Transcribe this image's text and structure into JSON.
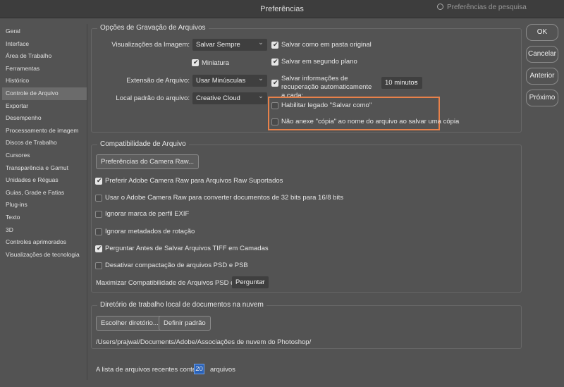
{
  "window": {
    "title": "Preferências",
    "search_placeholder": "Preferências de pesquisa"
  },
  "sidebar": {
    "items": [
      "Geral",
      "Interface",
      "Área de Trabalho",
      "Ferramentas",
      "Histórico",
      "Controle de Arquivo",
      "Exportar",
      "Desempenho",
      "Processamento de imagem",
      "Discos de Trabalho",
      "Cursores",
      "Transparência e Gamut",
      "Unidades e Réguas",
      "Guias, Grade e Fatias",
      "Plug-ins",
      "Texto",
      "3D",
      "Controles aprimorados",
      "Visualizações de tecnologia"
    ],
    "selected": "Controle de Arquivo"
  },
  "save_options": {
    "title": "Opções de Gravação de Arquivos",
    "image_previews_label": "Visualizações da Imagem:",
    "image_previews_value": "Salvar Sempre",
    "thumbnail": "Miniatura",
    "extension_label": "Extensão de Arquivo:",
    "extension_value": "Usar Minúsculas",
    "location_label": "Local padrão do arquivo:",
    "location_value": "Creative Cloud",
    "save_original": "Salvar como em pasta original",
    "save_background": "Salvar em segundo plano",
    "autosave": "Salvar informações de recuperação automaticamente a cada:",
    "autosave_value": "10 minutos",
    "legacy_save_as": "Habilitar legado \"Salvar como\"",
    "no_copy": "Não anexe \"cópia\" ao nome do arquivo ao salvar uma cópia"
  },
  "compat": {
    "title": "Compatibilidade de Arquivo",
    "camera_raw_btn": "Preferências do Camera Raw...",
    "options": [
      {
        "label": "Preferir Adobe Camera Raw para Arquivos Raw Suportados",
        "checked": true
      },
      {
        "label": "Usar o Adobe Camera Raw para converter documentos de 32 bits para 16/8 bits",
        "checked": false
      },
      {
        "label": "Ignorar marca de perfil EXIF",
        "checked": false
      },
      {
        "label": "Ignorar metadados de rotação",
        "checked": false
      },
      {
        "label": "Perguntar Antes de Salvar Arquivos TIFF em Camadas",
        "checked": true
      },
      {
        "label": "Desativar compactação de arquivos PSD e PSB",
        "checked": false
      }
    ],
    "maximize_label": "Maximizar Compatibilidade de Arquivos PSD e PSB:",
    "maximize_value": "Perguntar"
  },
  "cloud": {
    "title": "Diretório de trabalho local de documentos na nuvem",
    "choose_btn": "Escolher diretório...",
    "default_btn": "Definir padrão",
    "path": "/Users/prajwal/Documents/Adobe/Associações de nuvem do Photoshop/"
  },
  "recent": {
    "label": "A lista de arquivos recentes contém:",
    "value": "20",
    "unit": "arquivos"
  },
  "buttons": {
    "ok": "OK",
    "cancel": "Cancelar",
    "prev": "Anterior",
    "next": "Próximo"
  }
}
